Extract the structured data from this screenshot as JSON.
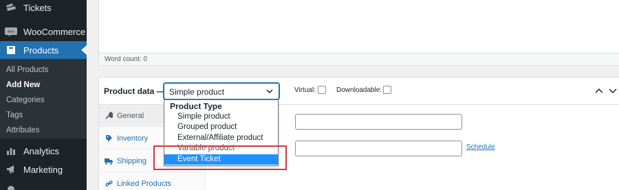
{
  "sidebar": {
    "items": [
      {
        "label": "Tickets",
        "icon": "tickets-icon"
      },
      {
        "label": "WooCommerce",
        "icon": "woocommerce-icon"
      },
      {
        "label": "Products",
        "icon": "products-icon"
      },
      {
        "label": "Analytics",
        "icon": "analytics-icon"
      },
      {
        "label": "Marketing",
        "icon": "marketing-icon"
      }
    ],
    "submenu": [
      "All Products",
      "Add New",
      "Categories",
      "Tags",
      "Attributes"
    ],
    "current_submenu": "Add New"
  },
  "editor": {
    "word_count": "Word count: 0"
  },
  "product_data": {
    "title": "Product data —",
    "type_select_value": "Simple product",
    "virtual_label": "Virtual:",
    "downloadable_label": "Downloadable:",
    "tabs": [
      {
        "label": "General",
        "icon": "wrench-icon"
      },
      {
        "label": "Inventory",
        "icon": "tag-icon"
      },
      {
        "label": "Shipping",
        "icon": "truck-icon"
      },
      {
        "label": "Linked Products",
        "icon": "link-icon"
      }
    ],
    "schedule_link": "Schedule"
  },
  "dropdown": {
    "group_label": "Product Type",
    "options": [
      "Simple product",
      "Grouped product",
      "External/Affiliate product",
      "Variable product",
      "Event Ticket"
    ],
    "highlighted": "Event Ticket"
  },
  "colors": {
    "sidebar_bg": "#1d2327",
    "accent": "#2271b1",
    "highlight_option": "#1e90ff",
    "annotation_red": "#d63638"
  }
}
